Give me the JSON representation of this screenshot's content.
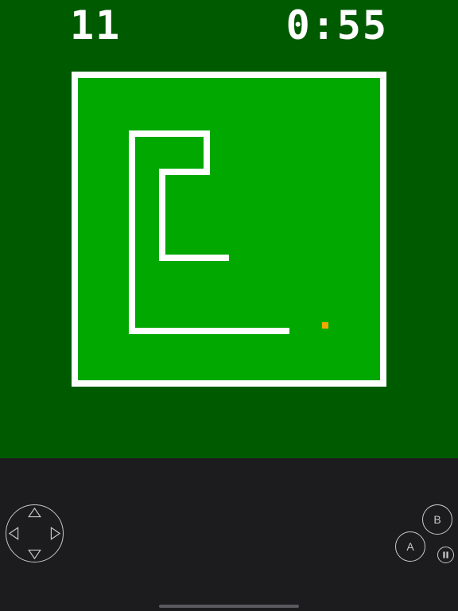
{
  "hud": {
    "score": "11",
    "timer": "0:55"
  },
  "controls": {
    "b_label": "B",
    "a_label": "A"
  },
  "colors": {
    "background": "#005a00",
    "board": "#00a800",
    "border": "#ffffff",
    "snake": "#ffffff",
    "food": "#f0a800",
    "controls_background": "#1c1c1e",
    "control_outline": "#c8c8c8"
  },
  "icons": [
    "dpad-up-icon",
    "dpad-down-icon",
    "dpad-left-icon",
    "dpad-right-icon",
    "pause-icon"
  ]
}
